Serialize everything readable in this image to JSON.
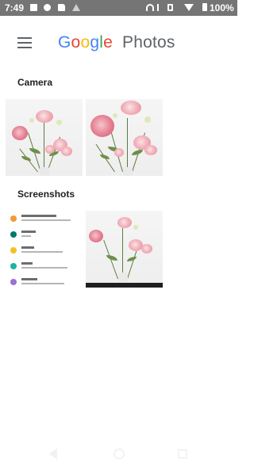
{
  "status_bar": {
    "time": "7:49",
    "battery": "100%",
    "left_icons": [
      "image-icon",
      "gear-icon",
      "sd-card-icon",
      "signal-off-icon"
    ],
    "right_icons": [
      "wifi-calling-icon",
      "bluetooth-icon",
      "vibrate-icon",
      "wifi-icon",
      "battery-icon"
    ]
  },
  "app_bar": {
    "menu_icon": "hamburger-menu-icon",
    "logo_letters": [
      "G",
      "o",
      "o",
      "g",
      "l",
      "e"
    ],
    "logo_colors": [
      "#4285F4",
      "#EA4335",
      "#FBBC05",
      "#4285F4",
      "#34A853",
      "#EA4335"
    ],
    "title_suffix": "Photos"
  },
  "sections": [
    {
      "title": "Camera",
      "items": [
        "flower-photo",
        "flower-photo"
      ]
    },
    {
      "title": "Screenshots",
      "items": [
        "settings-screenshot",
        "flower-photo"
      ],
      "screenshot_row_colors": [
        "#f29a3a",
        "#00796b",
        "#f2c21f",
        "#1cb3a4",
        "#9c6fd8"
      ]
    }
  ],
  "nav_bar": [
    "back-icon",
    "home-icon",
    "recents-icon"
  ]
}
